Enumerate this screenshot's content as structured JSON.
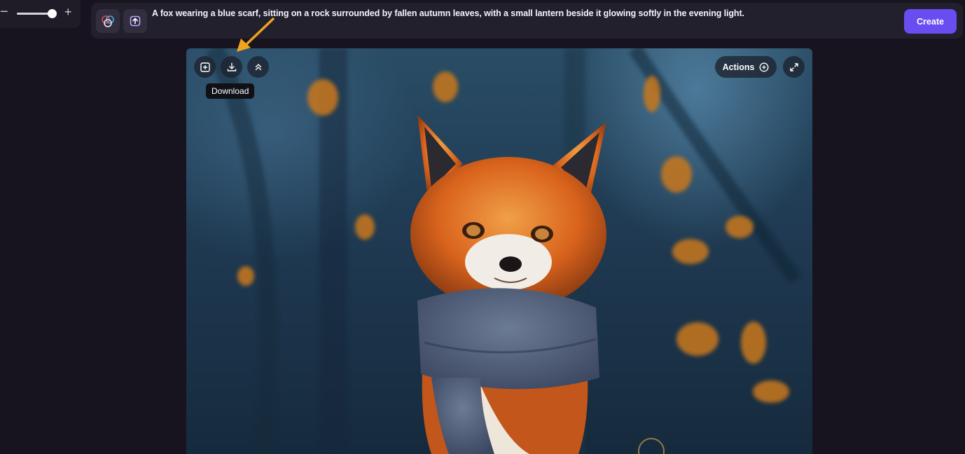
{
  "zoom": {
    "minus_label": "−",
    "plus_label": "+",
    "level": 0.9
  },
  "toolbar": {
    "color_tool_icon": "color-circles-icon",
    "upload_tool_icon": "upload-icon",
    "prompt": "A fox wearing a blue scarf, sitting on a rock surrounded by fallen autumn leaves, with a small lantern beside it glowing softly in the evening light.",
    "create_label": "Create"
  },
  "image_actions": {
    "add_icon": "add-square-icon",
    "download_icon": "download-icon",
    "collapse_icon": "chevrons-up-icon",
    "tooltip": "Download",
    "actions_label": "Actions",
    "actions_icon": "plus-circle-icon",
    "expand_icon": "expand-icon"
  },
  "colors": {
    "background": "#17141f",
    "panel": "#23202d",
    "accent": "#6a4df0",
    "arrow": "#f0a31d"
  }
}
